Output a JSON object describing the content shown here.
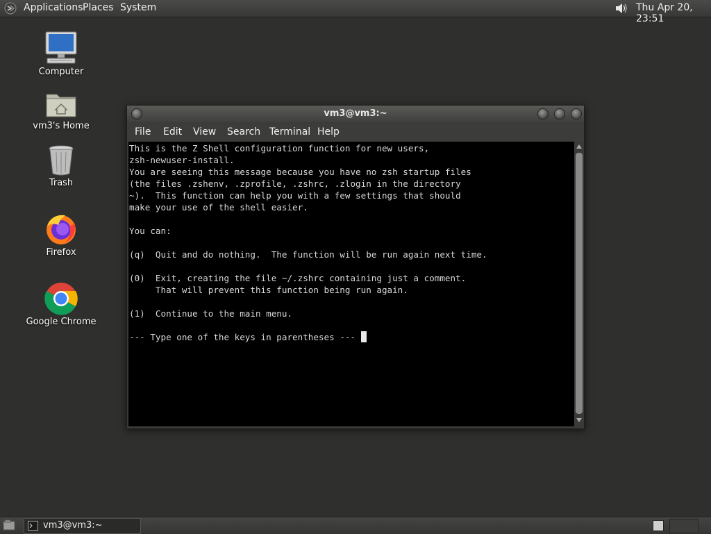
{
  "top_panel": {
    "menus": [
      "Applications",
      "Places",
      "System"
    ],
    "clock": "Thu Apr 20, 23:51"
  },
  "desktop": {
    "icons": [
      {
        "label": "Computer"
      },
      {
        "label": "vm3's Home"
      },
      {
        "label": "Trash"
      },
      {
        "label": "Firefox"
      },
      {
        "label": "Google Chrome"
      }
    ]
  },
  "terminal": {
    "title": "vm3@vm3:~",
    "menu": [
      "File",
      "Edit",
      "View",
      "Search",
      "Terminal",
      "Help"
    ],
    "content": "This is the Z Shell configuration function for new users,\nzsh-newuser-install.\nYou are seeing this message because you have no zsh startup files\n(the files .zshenv, .zprofile, .zshrc, .zlogin in the directory\n~).  This function can help you with a few settings that should\nmake your use of the shell easier.\n\nYou can:\n\n(q)  Quit and do nothing.  The function will be run again next time.\n\n(0)  Exit, creating the file ~/.zshrc containing just a comment.\n     That will prevent this function being run again.\n\n(1)  Continue to the main menu.\n\n--- Type one of the keys in parentheses --- "
  },
  "taskbar": {
    "window_label": "vm3@vm3:~"
  }
}
